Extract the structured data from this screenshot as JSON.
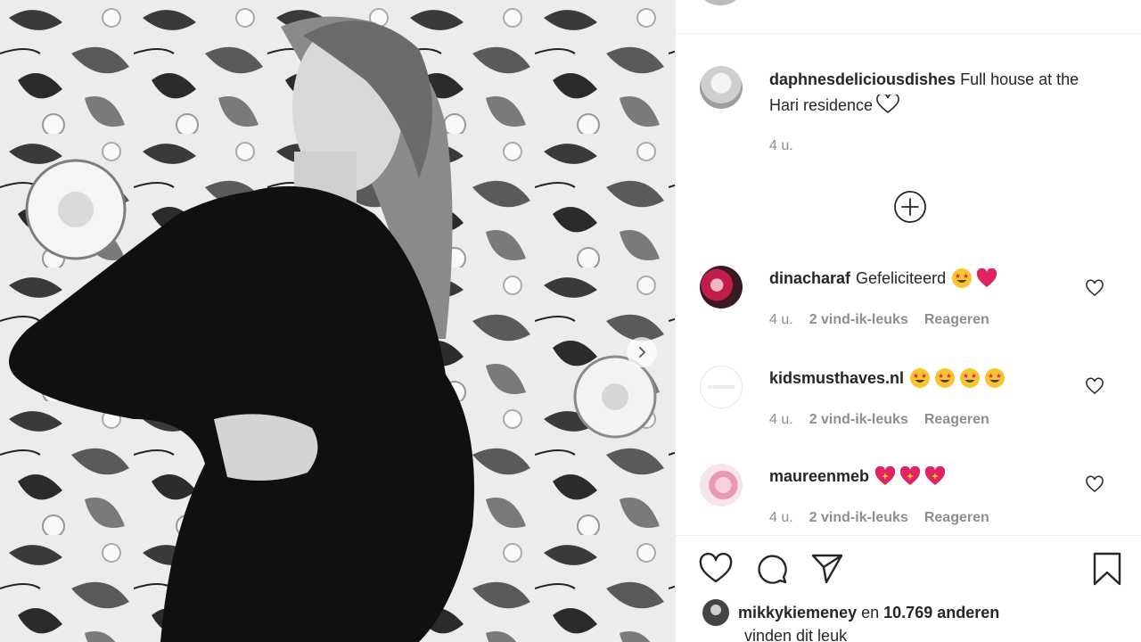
{
  "post": {
    "author": "daphnesdeliciousdishes",
    "caption": "Full house at the Hari residence",
    "time": "4 u."
  },
  "comments": [
    {
      "user": "dinacharaf",
      "text": "Gefeliciteerd",
      "emojis": [
        "star-struck-emoji",
        "red-heart-emoji"
      ],
      "time": "4 u.",
      "likes": "2 vind-ik-leuks",
      "reply": "Reageren"
    },
    {
      "user": "kidsmusthaves.nl",
      "text": "",
      "emojis": [
        "star-struck-emoji",
        "star-struck-emoji",
        "star-struck-emoji",
        "star-struck-emoji"
      ],
      "time": "4 u.",
      "likes": "2 vind-ik-leuks",
      "reply": "Reageren"
    },
    {
      "user": "maureenmeb",
      "text": "",
      "emojis": [
        "sparkling-heart-emoji",
        "sparkling-heart-emoji",
        "sparkling-heart-emoji"
      ],
      "time": "4 u.",
      "likes": "2 vind-ik-leuks",
      "reply": "Reageren"
    }
  ],
  "likes": {
    "user": "mikkykiemeney",
    "connector": "en",
    "others": "10.769 anderen",
    "suffix": "vinden dit leuk"
  },
  "icons": {
    "like": "heart-outline-icon",
    "comment": "comment-bubble-icon",
    "share": "paper-plane-icon",
    "save": "bookmark-icon",
    "load_more": "plus-circle-icon",
    "carousel_next": "chevron-right-icon"
  },
  "colors": {
    "text": "#262626",
    "muted": "#8e8e8e",
    "divider": "#efefef",
    "heart_red": "#e0245e"
  }
}
